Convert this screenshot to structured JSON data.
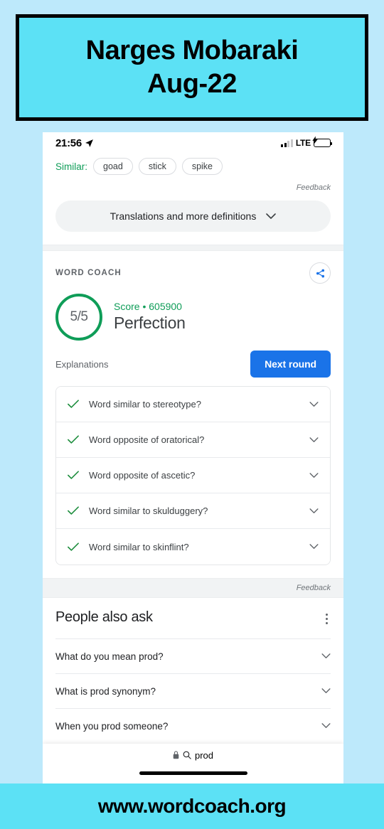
{
  "banner": {
    "name_line": "Narges Mobaraki",
    "date_line": "Aug-22"
  },
  "footer": {
    "url": "www.wordcoach.org"
  },
  "statusbar": {
    "time": "21:56",
    "carrier": "LTE",
    "location_icon": "location-arrow-icon",
    "signal_icon": "signal-bars-icon",
    "battery_icon": "battery-charging-icon"
  },
  "similar": {
    "label": "Similar:",
    "chips": [
      "goad",
      "stick",
      "spike"
    ],
    "feedback": "Feedback"
  },
  "translations": {
    "label": "Translations and more definitions",
    "chevron": "chevron-down-icon"
  },
  "word_coach": {
    "section_label": "WORD COACH",
    "share_icon": "share-icon",
    "score_fraction": "5/5",
    "score_line": "Score • 605900",
    "score_word": "Perfection",
    "explanations_label": "Explanations",
    "next_round_label": "Next round",
    "items": [
      {
        "text": "Word similar to stereotype?",
        "status": "correct"
      },
      {
        "text": "Word opposite of oratorical?",
        "status": "correct"
      },
      {
        "text": "Word opposite of ascetic?",
        "status": "correct"
      },
      {
        "text": "Word similar to skulduggery?",
        "status": "correct"
      },
      {
        "text": "Word similar to skinflint?",
        "status": "correct"
      }
    ],
    "feedback": "Feedback"
  },
  "people_also_ask": {
    "title": "People also ask",
    "menu_icon": "kebab-menu-icon",
    "questions": [
      "What do you mean prod?",
      "What is prod synonym?",
      "When you prod someone?"
    ]
  },
  "safari": {
    "lock_icon": "lock-icon",
    "search_icon": "search-icon",
    "url_text": "prod"
  },
  "colors": {
    "page_background": "#bde9fb",
    "banner_fill": "#5ce1f5",
    "accent_green": "#0f9d58",
    "accent_blue": "#1a73e8",
    "battery_green": "#34c759"
  }
}
